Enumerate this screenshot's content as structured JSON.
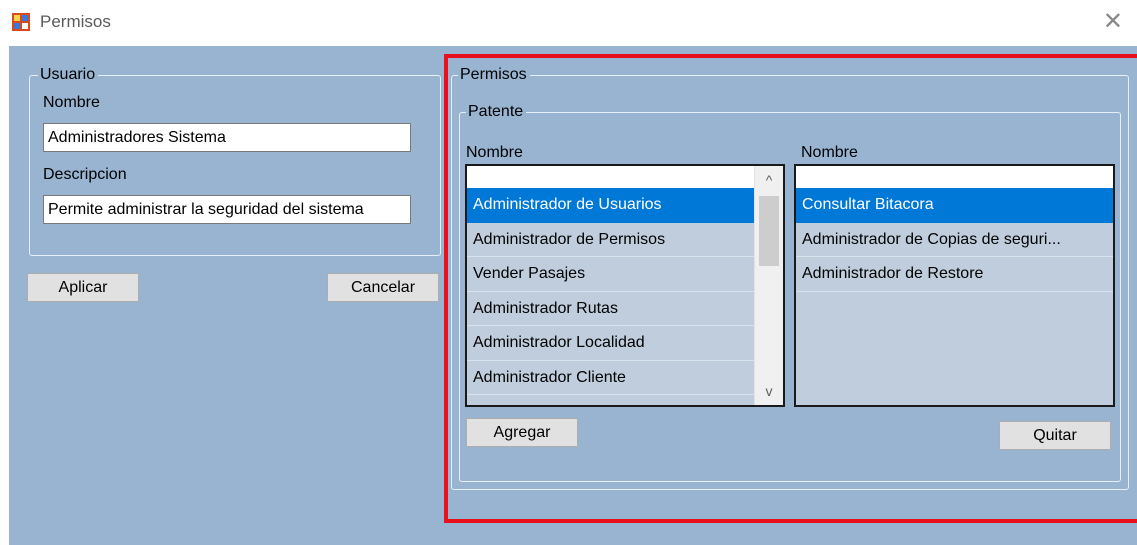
{
  "window": {
    "title": "Permisos",
    "close_glyph": "✕",
    "icon": "app-window-icon"
  },
  "usuario": {
    "group_label": "Usuario",
    "nombre_label": "Nombre",
    "nombre_value": "Administradores Sistema",
    "descripcion_label": "Descripcion",
    "descripcion_value": "Permite administrar la seguridad del sistema"
  },
  "buttons": {
    "aplicar": "Aplicar",
    "cancelar": "Cancelar",
    "agregar": "Agregar",
    "quitar": "Quitar"
  },
  "permisos": {
    "group_label": "Permisos",
    "patente_label": "Patente",
    "available": {
      "header": "Nombre",
      "items": [
        {
          "label": "Administrador de Usuarios",
          "selected": true
        },
        {
          "label": "Administrador de Permisos",
          "selected": false
        },
        {
          "label": "Vender Pasajes",
          "selected": false
        },
        {
          "label": "Administrador Rutas",
          "selected": false
        },
        {
          "label": "Administrador Localidad",
          "selected": false
        },
        {
          "label": "Administrador Cliente",
          "selected": false
        }
      ]
    },
    "assigned": {
      "header": "Nombre",
      "items": [
        {
          "label": "Consultar Bitacora",
          "selected": true
        },
        {
          "label": "Administrador de Copias de seguri...",
          "selected": false
        },
        {
          "label": "Administrador de Restore",
          "selected": false
        }
      ]
    }
  },
  "scroll": {
    "up_glyph": "^",
    "down_glyph": "v"
  },
  "colors": {
    "client_background": "#99b4d1",
    "selection": "#0078d7",
    "highlight_frame": "#e8101c"
  }
}
